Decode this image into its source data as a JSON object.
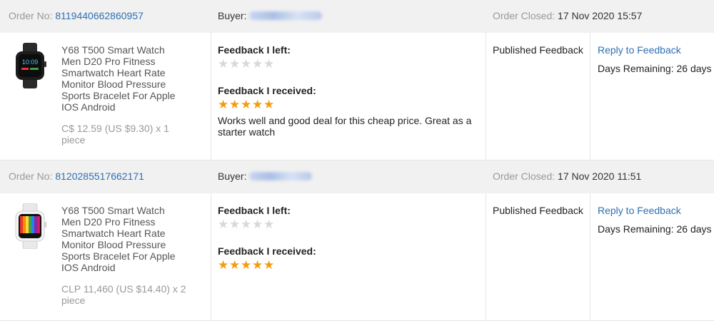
{
  "orders": [
    {
      "order_no_label": "Order No:",
      "order_no": "8119440662860957",
      "buyer_label": "Buyer:",
      "closed_label": "Order Closed:",
      "closed_date": "17 Nov 2020 15:57",
      "product_title": "Y68 T500 Smart Watch Men D20 Pro Fitness Smartwatch Heart Rate Monitor Blood Pressure Sports Bracelet For Apple IOS Android",
      "price": "C$ 12.59 (US $9.30) x 1 piece",
      "feedback_left_label": "Feedback I left:",
      "feedback_left_stars": 0,
      "feedback_received_label": "Feedback I received:",
      "feedback_received_stars": 5,
      "feedback_received_text": "Works well and good deal for this cheap price. Great as a starter watch",
      "status": "Published Feedback",
      "reply_label": "Reply to Feedback",
      "days_remaining": "Days Remaining: 26 days",
      "thumb_icon": "black-smartwatch-icon"
    },
    {
      "order_no_label": "Order No:",
      "order_no": "8120285517662171",
      "buyer_label": "Buyer:",
      "closed_label": "Order Closed:",
      "closed_date": "17 Nov 2020 11:51",
      "product_title": "Y68 T500 Smart Watch Men D20 Pro Fitness Smartwatch Heart Rate Monitor Blood Pressure Sports Bracelet For Apple IOS Android",
      "price": "CLP 11,460 (US $14.40) x 2 piece",
      "feedback_left_label": "Feedback I left:",
      "feedback_left_stars": 0,
      "feedback_received_label": "Feedback I received:",
      "feedback_received_stars": 5,
      "feedback_received_text": "",
      "status": "Published Feedback",
      "reply_label": "Reply to Feedback",
      "days_remaining": "Days Remaining: 26 days",
      "thumb_icon": "white-smartwatch-icon"
    }
  ],
  "colors": {
    "link": "#2f6fb3",
    "star_on": "#f39c0e",
    "star_off": "#d8d8d8",
    "header_bg": "#f1f1f1"
  }
}
